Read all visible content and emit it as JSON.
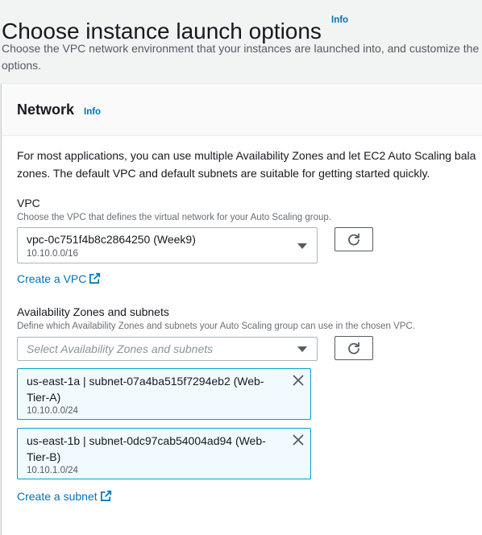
{
  "page": {
    "title": "Choose instance launch options",
    "info_label": "Info",
    "description_lines": [
      "Choose the VPC network environment that your instances are launched into, and customize the",
      "options."
    ]
  },
  "network": {
    "title": "Network",
    "info_label": "Info",
    "intro_lines": [
      "For most applications, you can use multiple Availability Zones and let EC2 Auto Scaling bala",
      "zones. The default VPC and default subnets are suitable for getting started quickly."
    ],
    "vpc": {
      "label": "VPC",
      "description": "Choose the VPC that defines the virtual network for your Auto Scaling group.",
      "selected_value": "vpc-0c751f4b8c2864250 (Week9)",
      "selected_cidr": "10.10.0.0/16",
      "refresh_icon": "refresh-icon",
      "create_link": "Create a VPC",
      "external_icon": "external-link-icon"
    },
    "availability_zones": {
      "label": "Availability Zones and subnets",
      "description": "Define which Availability Zones and subnets your Auto Scaling group can use in the chosen VPC.",
      "placeholder": "Select Availability Zones and subnets",
      "refresh_icon": "refresh-icon",
      "tokens": [
        {
          "label_lines": [
            "us-east-1a | subnet-07a4ba515f7294eb2 (Web-",
            "Tier-A)"
          ],
          "cidr": "10.10.0.0/24",
          "dismiss_icon": "close-icon"
        },
        {
          "label_lines": [
            "us-east-1b | subnet-0dc97cab54004ad94 (Web-",
            "Tier-B)"
          ],
          "cidr": "10.10.1.0/24",
          "dismiss_icon": "close-icon"
        }
      ],
      "create_link": "Create a subnet",
      "external_icon": "external-link-icon"
    }
  },
  "colors": {
    "link": "#0073bb",
    "token_border": "#00a1c9",
    "token_background": "#f1faff",
    "page_background": "#f2f3f3"
  }
}
